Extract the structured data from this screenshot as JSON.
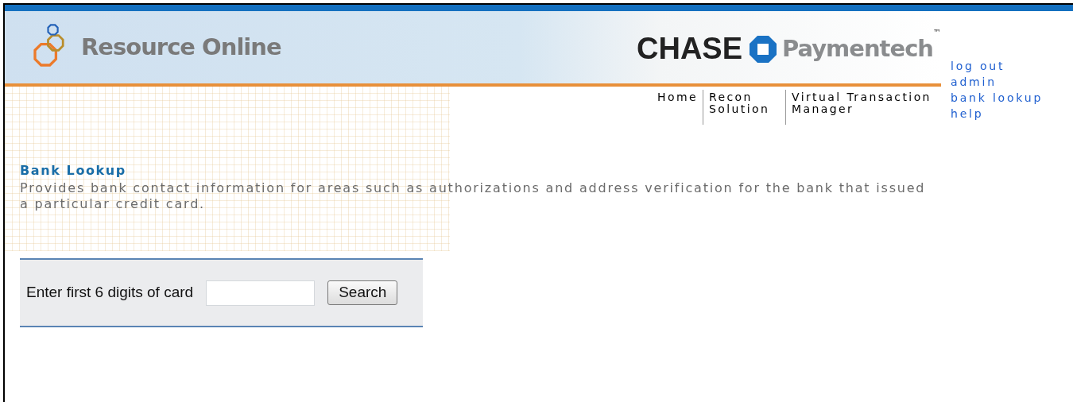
{
  "logo": {
    "text": "Resource Online"
  },
  "brand": {
    "name": "CHASE",
    "product": "Paymentech",
    "trademark": "™"
  },
  "nav": [
    {
      "label": "Home"
    },
    {
      "label": "Recon Solution"
    },
    {
      "label": "Virtual Transaction Manager"
    }
  ],
  "user_links": [
    "log out",
    "admin",
    "bank lookup",
    "help"
  ],
  "page": {
    "title": "Bank Lookup",
    "description": "Provides bank contact information for areas such as authorizations and address verification for the bank that issued a particular credit card."
  },
  "form": {
    "label": "Enter first 6 digits of card",
    "button": "Search"
  }
}
